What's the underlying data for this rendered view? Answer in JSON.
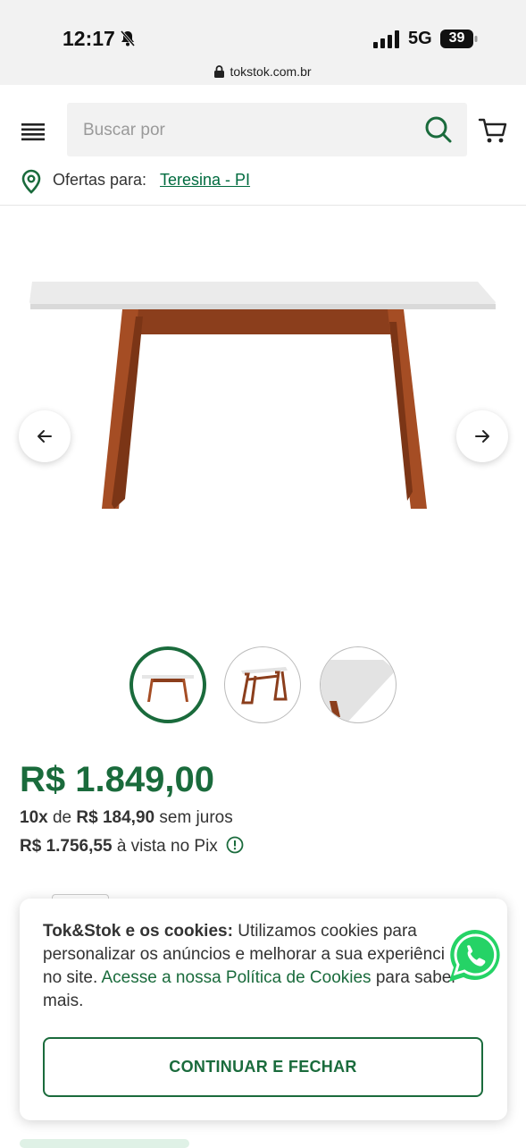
{
  "status_bar": {
    "time": "12:17",
    "network": "5G",
    "battery": "39",
    "url": "tokstok.com.br"
  },
  "header": {
    "search_placeholder": "Buscar por",
    "offer_label": "Ofertas para:",
    "offer_city": "Teresina - PI"
  },
  "product": {
    "price": "R$ 1.849,00",
    "installments": {
      "count": "10x",
      "of": "de",
      "value": "R$ 184,90",
      "suffix": "sem juros"
    },
    "pix": {
      "value": "R$ 1.756,55",
      "suffix": "à vista no Pix"
    },
    "thumbnails_count": 3,
    "active_thumbnail": 1
  },
  "cookie_banner": {
    "title": "Tok&Stok e os cookies:",
    "text": "Utilizamos cookies para personalizar os anúncios e melhorar a sua experiência no site.",
    "link": "Acesse a nossa Política de Cookies",
    "text_end": "para saber mais.",
    "button": "CONTINUAR E FECHAR"
  },
  "colors": {
    "brand_green": "#1a6b3c",
    "link_green": "#006b3f",
    "whatsapp": "#25d366"
  },
  "icons": [
    "bell-slash-icon",
    "signal-icon",
    "battery-icon",
    "lock-icon",
    "menu-icon",
    "search-icon",
    "cart-icon",
    "location-pin-icon",
    "arrow-left-icon",
    "arrow-right-icon",
    "info-icon",
    "whatsapp-icon"
  ]
}
